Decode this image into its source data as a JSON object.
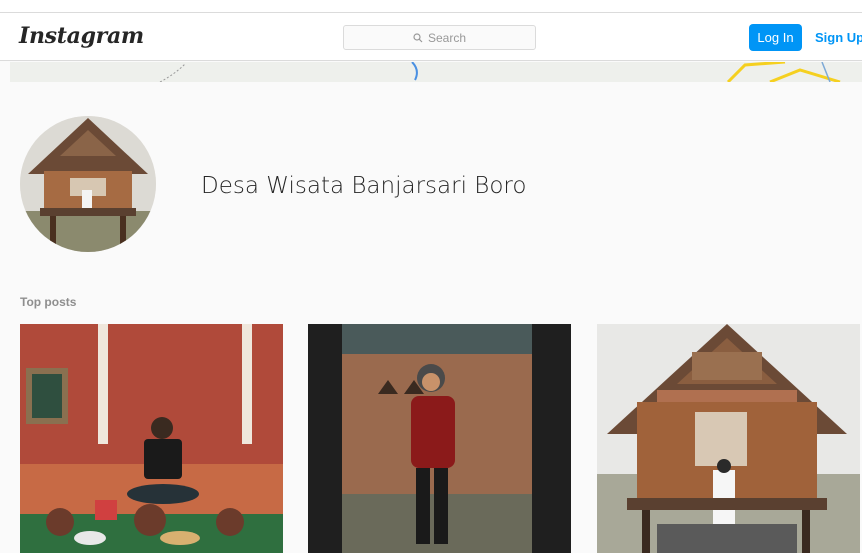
{
  "navbar": {
    "logo": "Instagram",
    "search_placeholder": "Search",
    "login_label": "Log In",
    "signup_label": "Sign Up"
  },
  "profile": {
    "name": "Desa Wisata Banjarsari Boro"
  },
  "top_posts": {
    "title": "Top posts"
  },
  "colors": {
    "accent": "#0095f6",
    "background": "#fafafa",
    "border": "#dbdbdb"
  },
  "icons": [
    "search-icon"
  ]
}
